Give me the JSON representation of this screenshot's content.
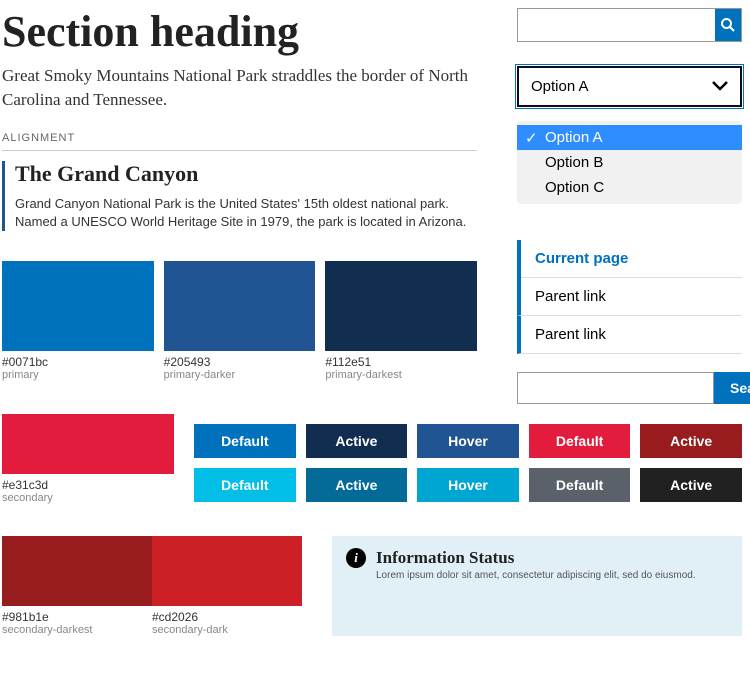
{
  "heading": "Section heading",
  "subheading": "Great Smoky Mountains National Park straddles the border of North Carolina and Tennessee.",
  "alignment_label": "ALIGNMENT",
  "card": {
    "title": "The Grand Canyon",
    "body": "Grand Canyon National Park is the United States' 15th oldest national park. Named a UNESCO World Heritage Site in 1979, the park is located in Arizona."
  },
  "swatches_primary": [
    {
      "hex": "#0071bc",
      "name": "primary"
    },
    {
      "hex": "#205493",
      "name": "primary-darker"
    },
    {
      "hex": "#112e51",
      "name": "primary-darkest"
    }
  ],
  "secondary": {
    "hex": "#e31c3d",
    "name": "secondary"
  },
  "buttons_row1": [
    {
      "label": "Default",
      "bg": "#0071bc"
    },
    {
      "label": "Active",
      "bg": "#112e51"
    },
    {
      "label": "Hover",
      "bg": "#205493"
    },
    {
      "label": "Default",
      "bg": "#e31c3d"
    },
    {
      "label": "Active",
      "bg": "#981b1e"
    }
  ],
  "buttons_row2": [
    {
      "label": "Default",
      "bg": "#02bfe7"
    },
    {
      "label": "Active",
      "bg": "#046b99"
    },
    {
      "label": "Hover",
      "bg": "#00a6d2"
    },
    {
      "label": "Default",
      "bg": "#5b616b"
    },
    {
      "label": "Active",
      "bg": "#212121"
    }
  ],
  "secondary_swatches": [
    {
      "hex": "#981b1e",
      "name": "secondary-darkest"
    },
    {
      "hex": "#cd2026",
      "name": "secondary-dark"
    }
  ],
  "info": {
    "title": "Information Status",
    "body": "Lorem ipsum dolor sit amet, consectetur adipiscing elit, sed do eiusmod."
  },
  "dropdown": {
    "selected": "Option A",
    "options": [
      "Option A",
      "Option B",
      "Option C"
    ]
  },
  "sidenav": {
    "current": "Current page",
    "parent1": "Parent link",
    "parent2": "Parent link"
  },
  "search2_label": "Search"
}
